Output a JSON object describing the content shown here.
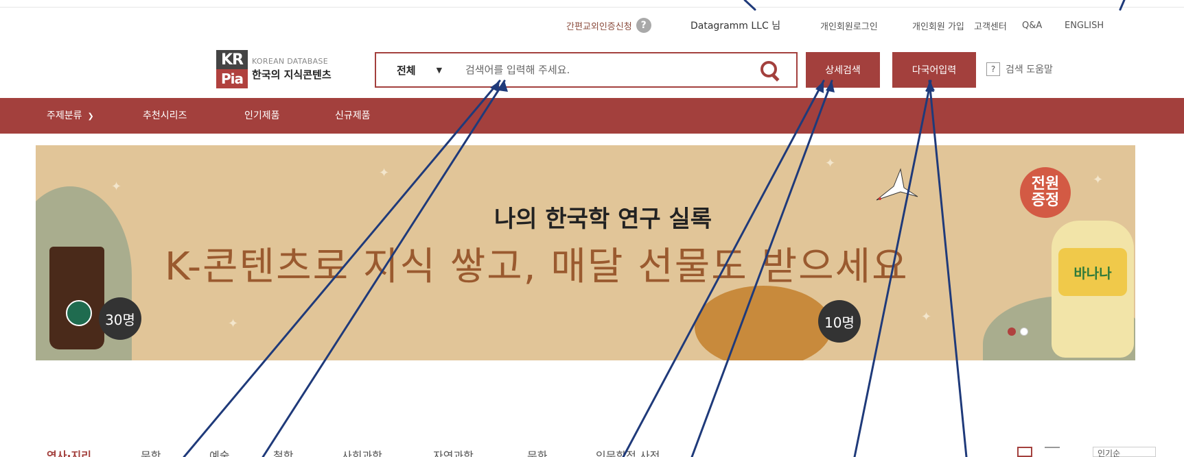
{
  "util": {
    "cert_label": "간편교외인증신청",
    "help_glyph": "?",
    "user_label": "Datagramm LLC 님",
    "links": [
      "개인회원로그인",
      "개인회원 가입",
      "고객센터",
      "Q&A",
      "ENGLISH"
    ]
  },
  "logo": {
    "mark_top": "KR",
    "mark_bottom": "Pia",
    "en": "KOREAN DATABASE",
    "ko": "한국의 지식콘텐츠"
  },
  "search": {
    "scope": "전체",
    "placeholder": "검색어를 입력해 주세요.",
    "value": ""
  },
  "buttons": {
    "advanced": "상세검색",
    "multilang": "다국어입력",
    "help_box": "?",
    "help": "검색 도움말"
  },
  "nav": {
    "items": [
      "주제분류",
      "추천시리즈",
      "인기제품",
      "신규제품"
    ]
  },
  "banner": {
    "subtitle": "나의 한국학 연구 실록",
    "headline": "K-콘텐츠로 지식 쌓고, 매달 선물도 받으세요",
    "badge_left": "30명",
    "badge_mid": "10명",
    "gift_line1": "전원",
    "gift_line2": "증정",
    "milk_label": "바나나"
  },
  "categories": {
    "items": [
      "역사·지리",
      "문학",
      "예술",
      "철학",
      "사회과학",
      "자연과학",
      "문화",
      "인문학적 사전"
    ],
    "sort": "인기순"
  },
  "colors": {
    "brand": "#a3403d",
    "annotation": "#1f3a7a",
    "banner_bg": "#e1c598"
  }
}
